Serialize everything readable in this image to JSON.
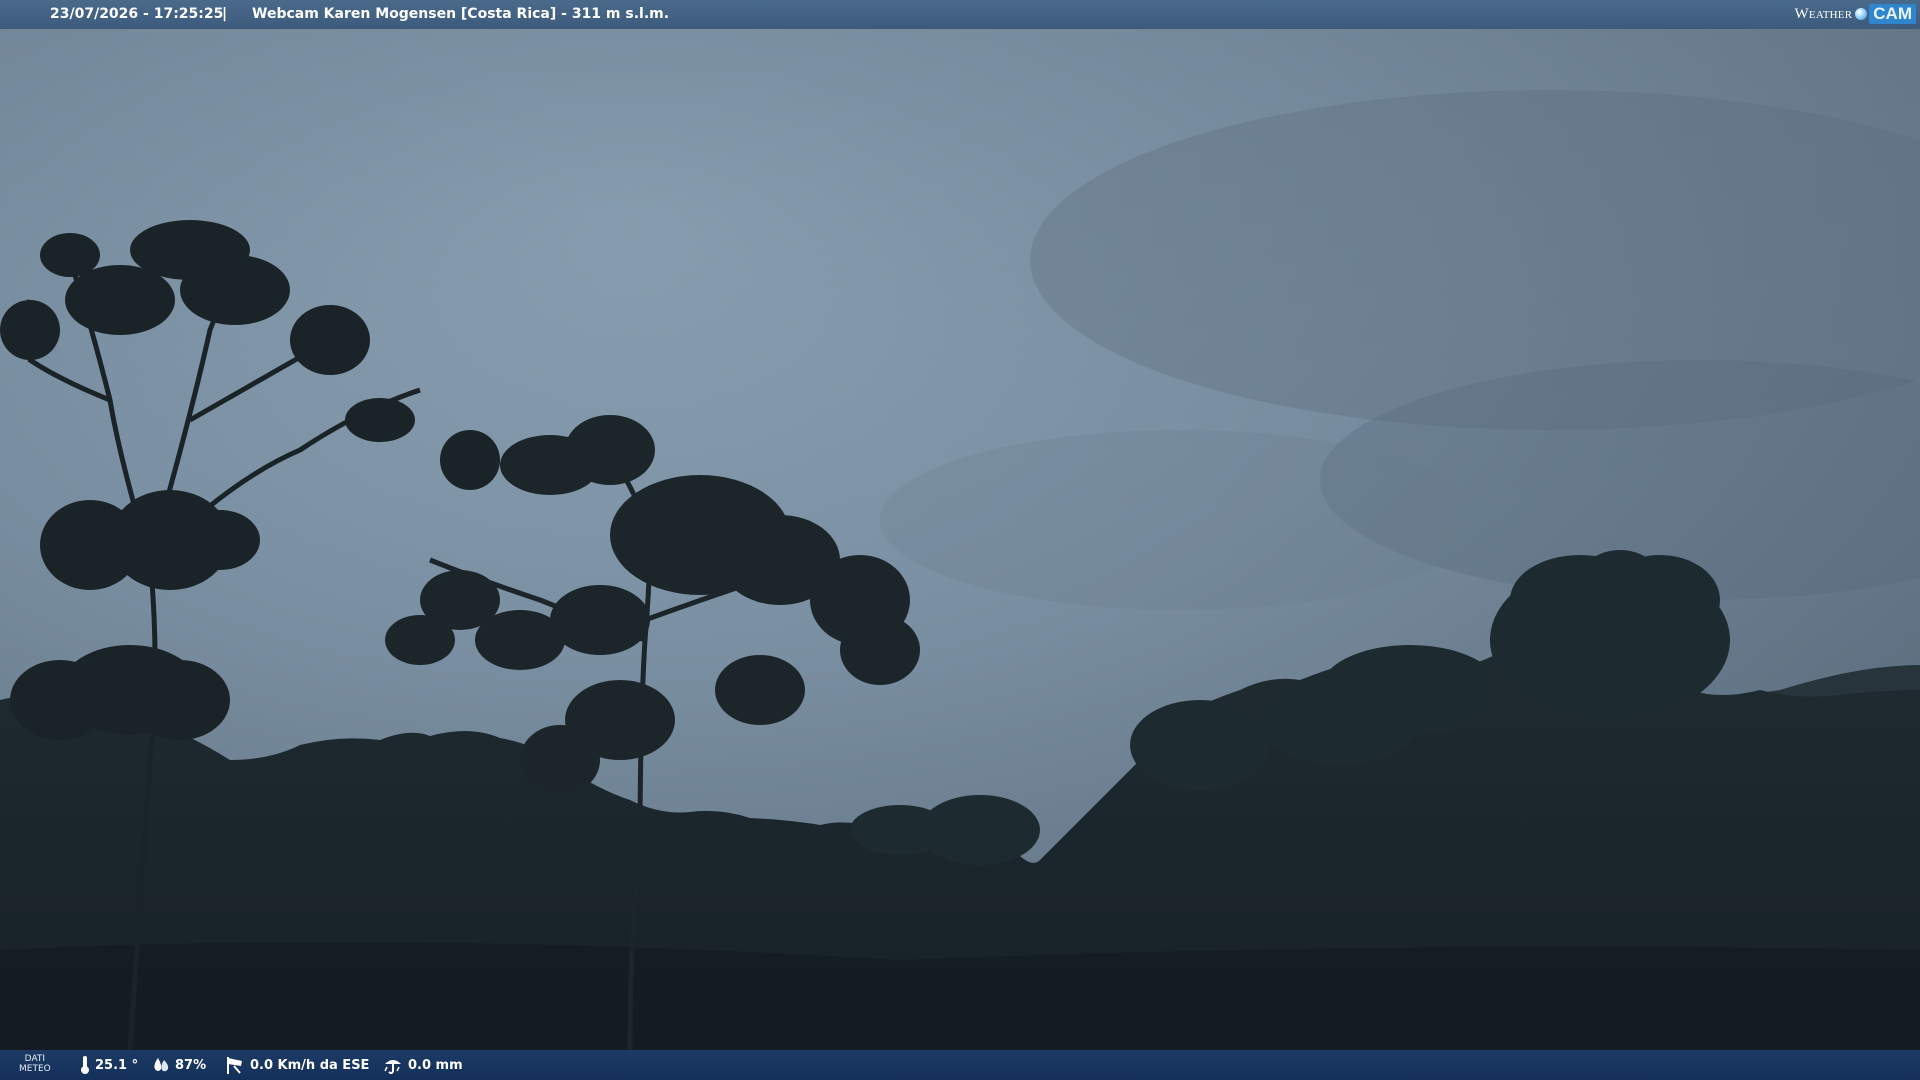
{
  "header": {
    "datetime": "23/07/2026 - 17:25:25",
    "separator": "|",
    "camera_title": "Webcam Karen Mogensen [Costa Rica]  - 311 m s.l.m."
  },
  "logo": {
    "word": "Weather",
    "cam": "CAM"
  },
  "meteo": {
    "label_line1": "DATI",
    "label_line2": "METEO",
    "temperature": "25.1 °",
    "humidity": "87%",
    "wind": "0.0 Km/h da ESE",
    "rain": "0.0 mm"
  },
  "colors": {
    "top_bar": "#4a6a8c",
    "bottom_bar": "#1c3a64",
    "sky": "#7d92a4",
    "foliage": "#1a2329"
  },
  "icons": {
    "temperature": "thermometer-icon",
    "humidity": "droplet-icon",
    "wind": "wind-sock-icon",
    "rain": "rain-gauge-icon"
  }
}
